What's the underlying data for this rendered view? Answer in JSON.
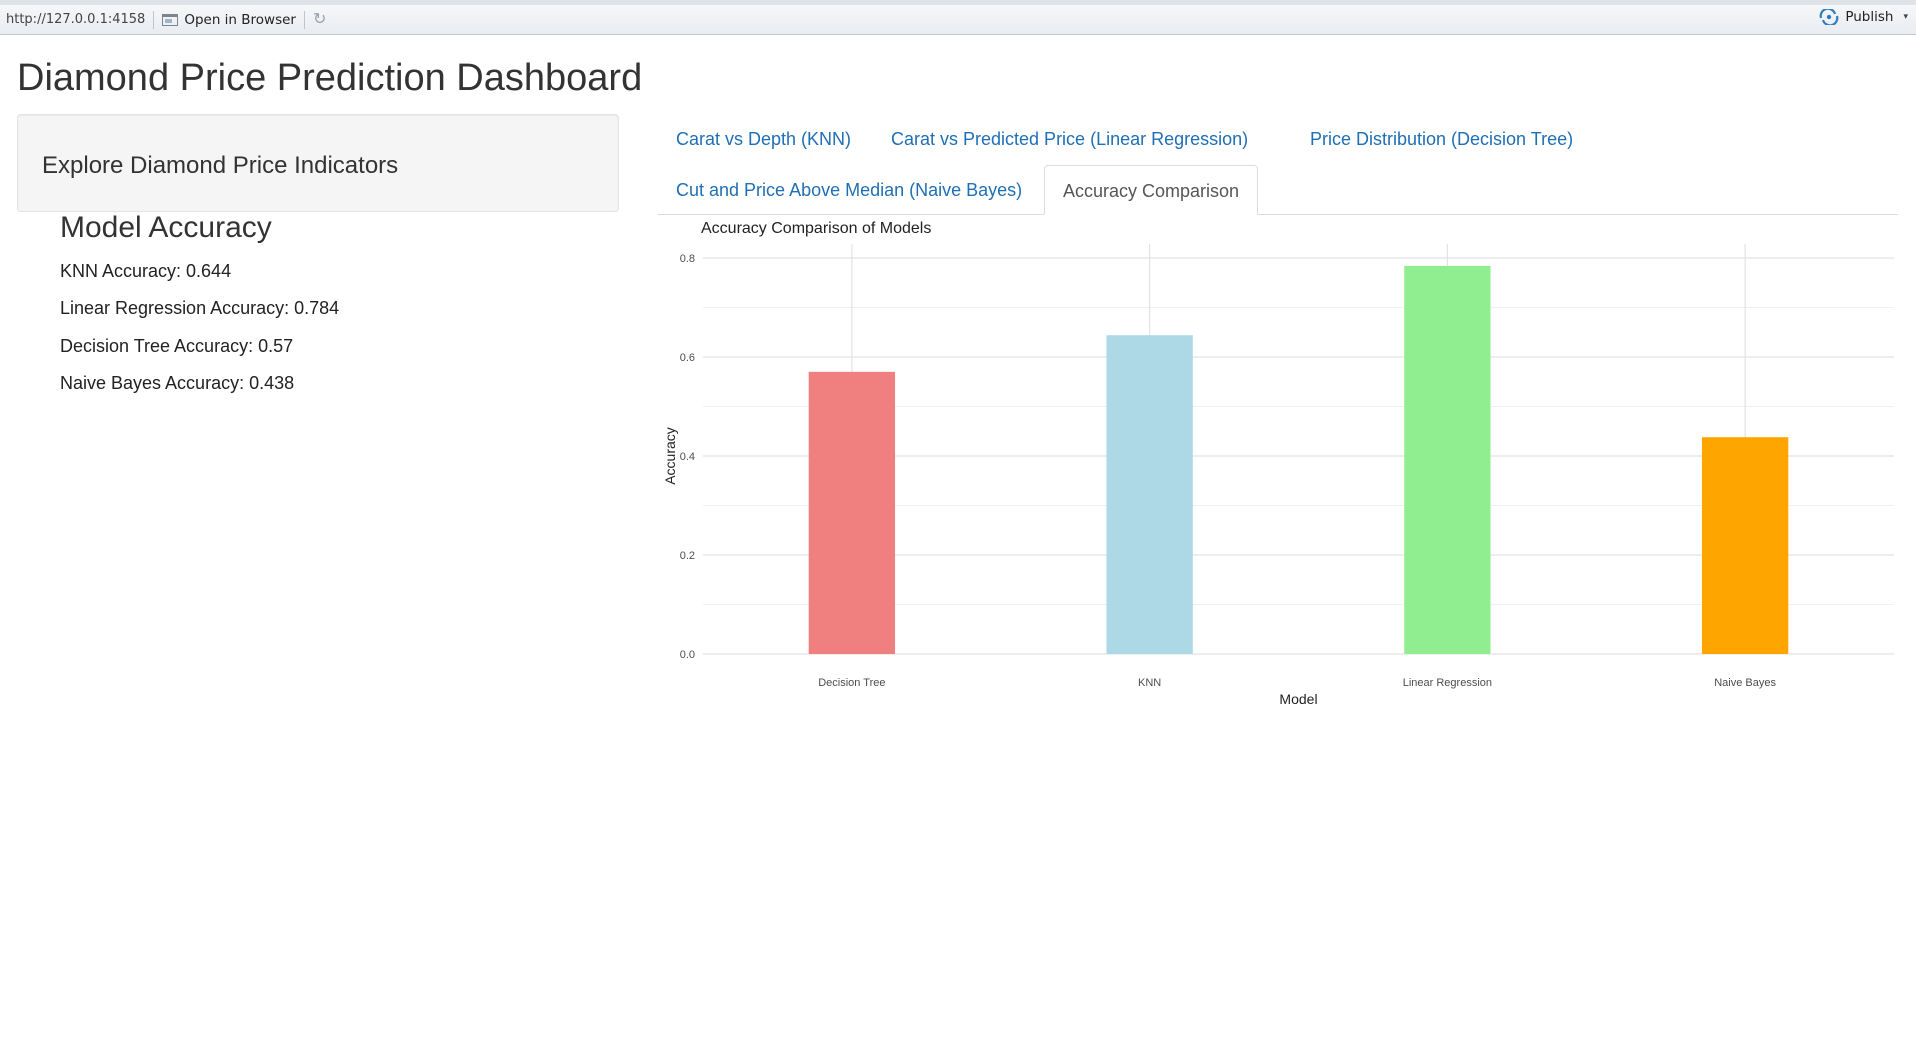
{
  "toolbar": {
    "url": "http://127.0.0.1:4158",
    "open_label": "Open in Browser",
    "publish_label": "Publish",
    "publish_color": "#2e7fc2"
  },
  "page": {
    "title": "Diamond Price Prediction Dashboard"
  },
  "sidebar": {
    "well_text": "Explore Diamond Price Indicators",
    "accuracy_title": "Model Accuracy",
    "lines": [
      "KNN Accuracy: 0.644",
      "Linear Regression Accuracy: 0.784",
      "Decision Tree Accuracy: 0.57",
      "Naive Bayes Accuracy: 0.438"
    ]
  },
  "tabs": [
    {
      "label": "Carat vs Depth (KNN)",
      "active": false
    },
    {
      "label": "Carat vs Predicted Price (Linear Regression)",
      "active": false
    },
    {
      "label": "Price Distribution (Decision Tree)",
      "active": false
    },
    {
      "label": "Cut and Price Above Median (Naive Bayes)",
      "active": false
    },
    {
      "label": "Accuracy Comparison",
      "active": true
    }
  ],
  "colors": {
    "link": "#1f6fb5"
  },
  "chart_data": {
    "type": "bar",
    "title": "Accuracy Comparison of Models",
    "xlabel": "Model",
    "ylabel": "Accuracy",
    "categories": [
      "Decision Tree",
      "KNN",
      "Linear Regression",
      "Naive Bayes"
    ],
    "values": [
      0.57,
      0.644,
      0.784,
      0.438
    ],
    "colors": [
      "#f08080",
      "#add8e6",
      "#90ee90",
      "#ffa500"
    ],
    "ylim": [
      0,
      0.8
    ],
    "yticks": [
      0.0,
      0.2,
      0.4,
      0.6,
      0.8
    ],
    "ytick_labels": [
      "0.0",
      "0.2",
      "0.4",
      "0.6",
      "0.8"
    ],
    "grid": true,
    "legend": "none"
  }
}
